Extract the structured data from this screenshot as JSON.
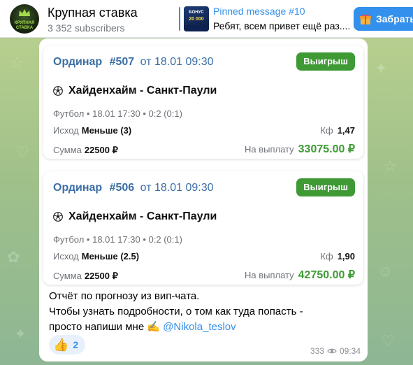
{
  "channel": {
    "title": "Крупная ставка",
    "subscribers": "3 352 subscribers",
    "avatar_text": "КРУПНАЯ СТАВКА"
  },
  "pinned": {
    "label": "Pinned message #10",
    "preview": "Ребят, всем привет ещё раз....",
    "thumb_line1": "БОНУС",
    "thumb_line2": "20 000"
  },
  "gift_button": {
    "label": "Забрать",
    "icon": "gift-icon"
  },
  "cards": [
    {
      "type": "Ординар",
      "number": "#507",
      "date": "от 18.01 09:30",
      "badge": "Выигрыш",
      "match": "Хайденхайм - Санкт-Паули",
      "meta": "Футбол • 18.01 17:30 • 0:2 (0:1)",
      "outcome_label": "Исход",
      "outcome_value": "Меньше (3)",
      "coef_label": "Кф",
      "coef_value": "1,47",
      "sum_label": "Сумма",
      "sum_value": "22500 ₽",
      "payout_label": "На выплату",
      "payout_value": "33075.00 ₽"
    },
    {
      "type": "Ординар",
      "number": "#506",
      "date": "от 18.01 09:30",
      "badge": "Выигрыш",
      "match": "Хайденхайм - Санкт-Паули",
      "meta": "Футбол • 18.01 17:30 • 0:2 (0:1)",
      "outcome_label": "Исход",
      "outcome_value": "Меньше (2.5)",
      "coef_label": "Кф",
      "coef_value": "1,90",
      "sum_label": "Сумма",
      "sum_value": "22500 ₽",
      "payout_label": "На выплату",
      "payout_value": "42750.00 ₽"
    }
  ],
  "message": {
    "line1": "Отчёт по прогнозу из вип-чата.",
    "line2": "Чтобы узнать подробности, о том как туда попасть -",
    "line3_prefix": "просто напиши мне ✍️ ",
    "mention": "@Nikola_teslov",
    "reaction_emoji": "👍",
    "reaction_count": "2",
    "views": "333",
    "time": "09:34"
  },
  "colors": {
    "accent": "#3390ec",
    "win": "#3f9a35",
    "card_title": "#3b6fa6"
  }
}
